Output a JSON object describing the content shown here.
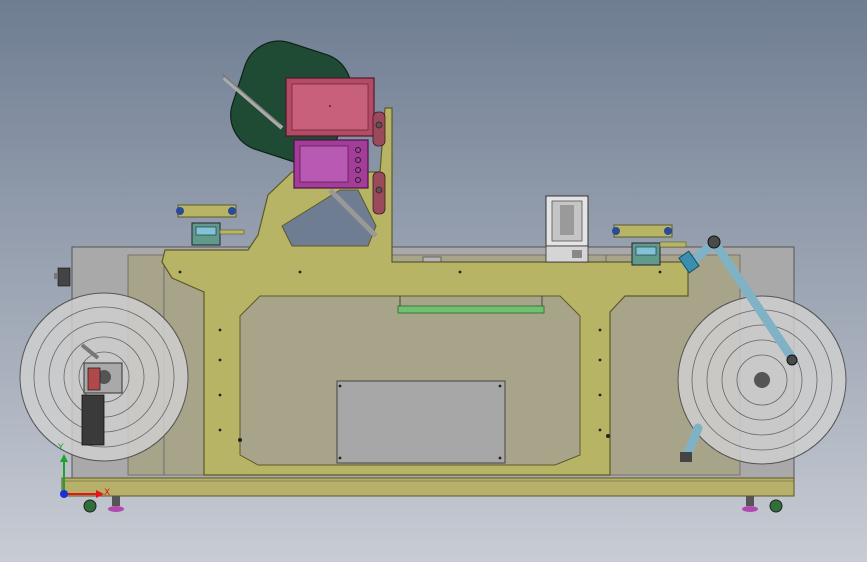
{
  "viewport": {
    "background_top": "#6f7d92",
    "background_bottom": "#c8ccd4"
  },
  "triad": {
    "x_label": "X",
    "y_label": "Y",
    "x_color": "#e8121b",
    "y_color": "#1fa32a",
    "z_color": "#1c2fd6"
  },
  "colors": {
    "frame_plate": "#b8b465",
    "frame_edge": "#5c5a2a",
    "base_rail": "#b6b06a",
    "back_panel": "#a9a9a9",
    "inner_panel": "#a8a48a",
    "cover_plate": "#a7a7a7",
    "reel_face": "#cfcfcf",
    "screen_outer": "#b44a66",
    "screen_inner": "#c9607a",
    "hmi_outer": "#a43c9a",
    "hmi_inner": "#b85ab3",
    "fan_housing": "#1f4a34",
    "dancer_arm": "#7fb2c4",
    "guide_bar": "#6fc06f",
    "sensor_body": "#5f9a8b",
    "sensor_screen": "#82c2d6"
  }
}
